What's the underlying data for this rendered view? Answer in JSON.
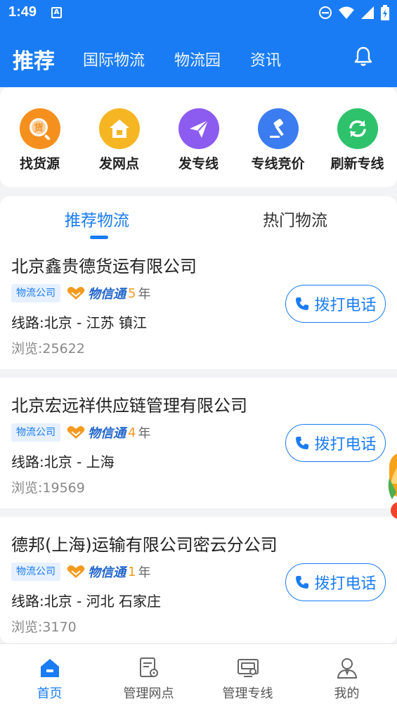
{
  "status_bar": {
    "time": "1:49",
    "a_icon": "A"
  },
  "header": {
    "active": "推荐",
    "nav": [
      "国际物流",
      "物流园",
      "资讯"
    ]
  },
  "actions": [
    {
      "label": "找货源",
      "icon": "goods-source-icon",
      "color": "#f5901e",
      "glyph": "货"
    },
    {
      "label": "发网点",
      "icon": "house-icon",
      "color": "#f6b623"
    },
    {
      "label": "发专线",
      "icon": "paper-plane-icon",
      "color": "#8c5cf0"
    },
    {
      "label": "专线竞价",
      "icon": "gavel-icon",
      "color": "#3b7cf0"
    },
    {
      "label": "刷新专线",
      "icon": "refresh-icon",
      "color": "#2dc26b"
    }
  ],
  "tabs": {
    "recommended": "推荐物流",
    "hot": "热门物流"
  },
  "companies": [
    {
      "name": "北京鑫贵德货运有限公司",
      "badge": "物流公司",
      "brand": "物信通",
      "years": "5",
      "year_unit": "年",
      "route": "线路:北京 - 江苏 镇江",
      "views": "浏览:25622",
      "call": "拨打电话"
    },
    {
      "name": "北京宏远祥供应链管理有限公司",
      "badge": "物流公司",
      "brand": "物信通",
      "years": "4",
      "year_unit": "年",
      "route": "线路:北京 - 上海",
      "views": "浏览:19569",
      "call": "拨打电话"
    },
    {
      "name": "德邦(上海)运输有限公司密云分公司",
      "badge": "物流公司",
      "brand": "物信通",
      "years": "1",
      "year_unit": "年",
      "route": "线路:北京 - 河北 石家庄",
      "views": "浏览:3170",
      "call": "拨打电话"
    }
  ],
  "tabbar": [
    {
      "label": "首页",
      "icon": "home-icon",
      "active": true
    },
    {
      "label": "管理网点",
      "icon": "manage-outlet-icon",
      "active": false
    },
    {
      "label": "管理专线",
      "icon": "manage-line-icon",
      "active": false
    },
    {
      "label": "我的",
      "icon": "profile-icon",
      "active": false
    }
  ],
  "colors": {
    "primary": "#1a7cf5",
    "accent_orange": "#f39a1e"
  }
}
